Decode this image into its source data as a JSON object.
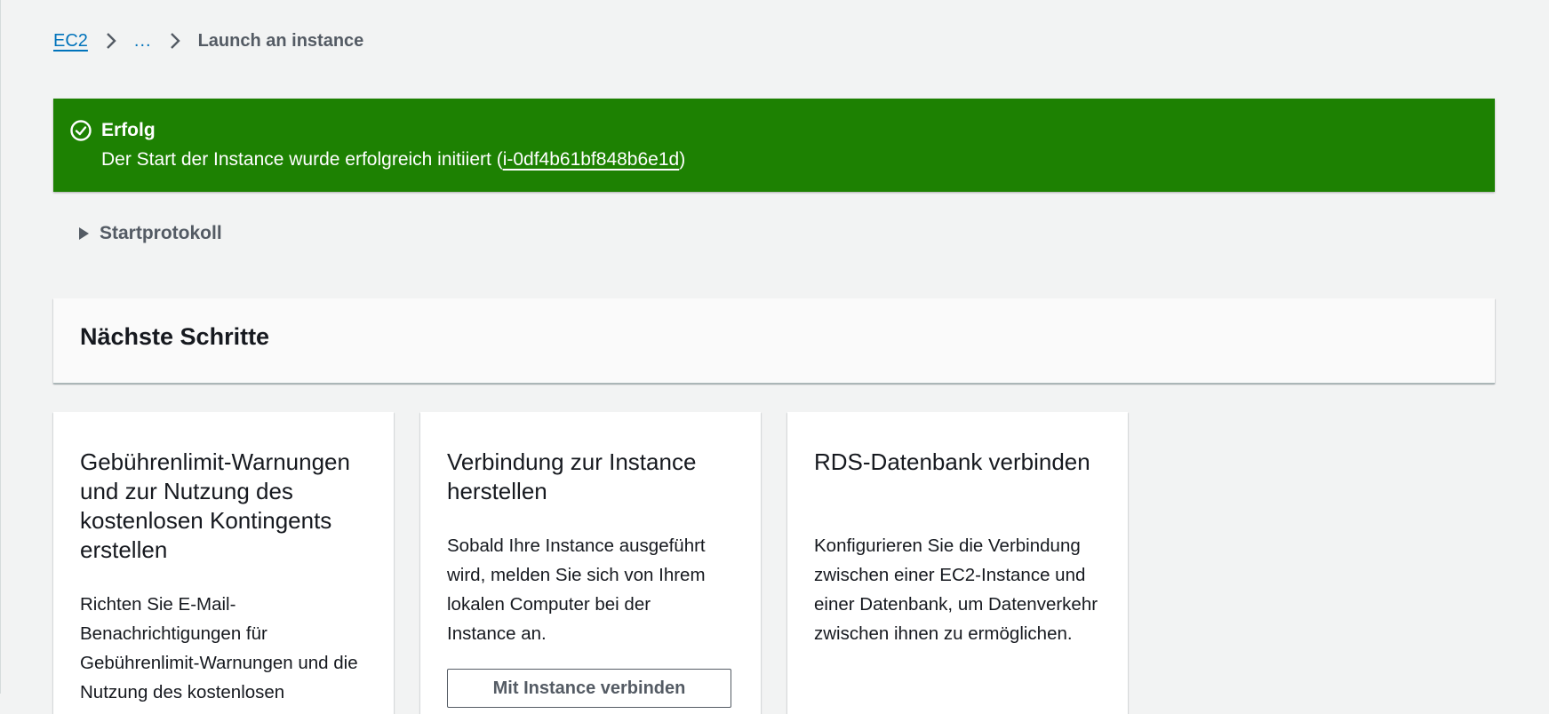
{
  "breadcrumb": {
    "root": "EC2",
    "ellipsis": "...",
    "current": "Launch an instance"
  },
  "flash": {
    "status": "success",
    "icon": "check-circle-icon",
    "title": "Erfolg",
    "message_prefix": "Der Start der Instance wurde erfolgreich initiiert (",
    "instance_id": "i-0df4b61bf848b6e1d",
    "message_suffix": ")"
  },
  "expander": {
    "label": "Startprotokoll",
    "expanded": false
  },
  "next_steps": {
    "title": "Nächste Schritte",
    "cards": [
      {
        "title": "Gebührenlimit-Warnungen und zur Nutzung des kostenlosen Kontingents erstellen",
        "body": "Richten Sie E-Mail-Benachrichtigungen für Gebührenlimit-Warnungen und die Nutzung des kostenlosen"
      },
      {
        "title": "Verbindung zur Instance herstellen",
        "body": "Sobald Ihre Instance ausgeführt wird, melden Sie sich von Ihrem lokalen Computer bei der Instance an.",
        "button": "Mit Instance verbinden"
      },
      {
        "title": "RDS-Datenbank verbinden",
        "body": "Konfigurieren Sie die Verbindung zwischen einer EC2-Instance und einer Datenbank, um Datenverkehr zwischen ihnen zu ermöglichen."
      }
    ]
  },
  "colors": {
    "page_background": "#f2f3f3",
    "link": "#0073bb",
    "success": "#1d8102",
    "muted_text": "#545b64",
    "text": "#16191f"
  }
}
